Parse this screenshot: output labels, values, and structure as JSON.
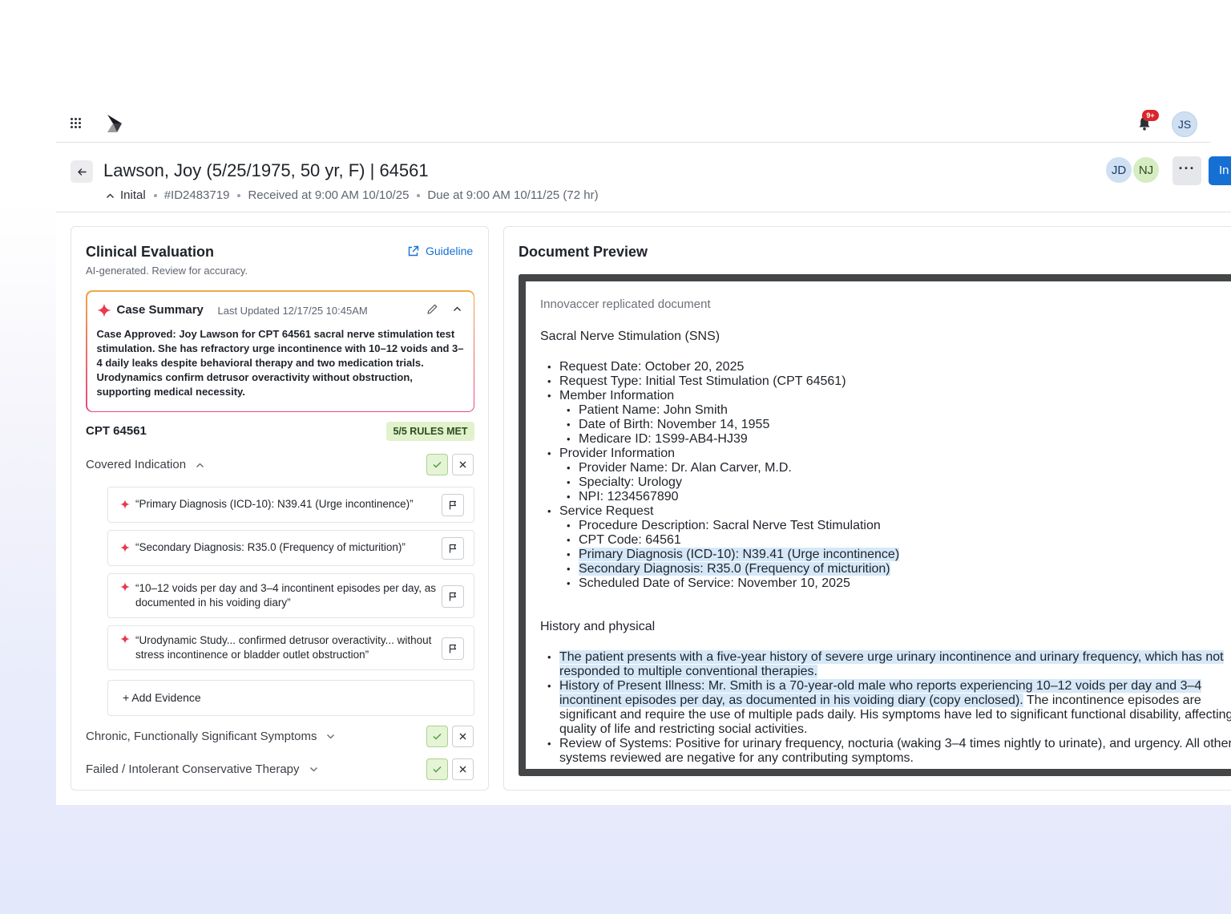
{
  "topbar": {
    "notification_count": "9+",
    "user_initials": "JS"
  },
  "header": {
    "title": "Lawson, Joy (5/25/1975, 50 yr, F) | 64561",
    "stage": "Inital",
    "case_id": "#ID2483719",
    "received": "Received at 9:00 AM 10/10/25",
    "due": "Due at 9:00 AM 10/11/25 (72 hr)",
    "assignees": [
      "JD",
      "NJ"
    ],
    "more_label": "···",
    "primary_button_label": "In"
  },
  "clinical": {
    "title": "Clinical Evaluation",
    "subtitle": "AI-generated. Review for accuracy.",
    "guideline_label": "Guideline",
    "summary": {
      "title": "Case Summary",
      "updated": "Last Updated 12/17/25 10:45AM",
      "body": "Case Approved: Joy Lawson for CPT 64561 sacral nerve stimulation test stimulation. She has refractory urge incontinence with 10–12 voids and 3–4 daily leaks despite behavioral therapy and two medication trials. Urodynamics confirm detrusor overactivity without obstruction, supporting medical necessity."
    },
    "cpt_label": "CPT 64561",
    "rules_badge": "5/5 RULES MET",
    "criteria": [
      {
        "label": "Covered Indication",
        "expanded": true
      },
      {
        "label": "Chronic, Functionally Significant Symptoms",
        "expanded": false
      },
      {
        "label": "Failed / Intolerant Conservative Therapy",
        "expanded": false
      }
    ],
    "evidence": [
      "“Primary Diagnosis (ICD-10): N39.41 (Urge incontinence)”",
      "“Secondary Diagnosis: R35.0 (Frequency of micturition)”",
      "“10–12 voids per day and 3–4 incontinent episodes per day, as documented in his voiding diary”",
      "“Urodynamic Study... confirmed detrusor overactivity... without stress incontinence or bladder outlet obstruction”"
    ],
    "add_evidence_label": "+  Add Evidence"
  },
  "document": {
    "title": "Document Preview",
    "source": "Innovaccer replicated document",
    "heading": "Sacral Nerve Stimulation (SNS)",
    "request_date": "Request Date: October 20, 2025",
    "request_type": "Request Type: Initial Test Stimulation (CPT 64561)",
    "member_info": "Member Information",
    "patient_name": "Patient Name: John Smith",
    "dob": "Date of Birth: November 14, 1955",
    "medicare_id": "Medicare ID: 1S99-AB4-HJ39",
    "provider_info": "Provider Information",
    "provider_name": "Provider Name: Dr. Alan Carver, M.D.",
    "specialty": "Specialty: Urology",
    "npi": "NPI: 1234567890",
    "service_request": "Service Request",
    "procedure": "Procedure Description: Sacral Nerve Test Stimulation",
    "cpt_code": "CPT Code: 64561",
    "primary_dx": "Primary Diagnosis (ICD-10): N39.41 (Urge incontinence)",
    "secondary_dx": "Secondary Diagnosis: R35.0 (Frequency of micturition)",
    "scheduled": "Scheduled Date of Service: November 10, 2025",
    "history_heading": "History and physical",
    "hp1": "The patient presents with a five-year history of severe urge urinary incontinence and urinary frequency, which has not responded to multiple conventional therapies.",
    "hp2_highlight": "History of Present Illness: Mr. Smith is a 70-year-old male who reports experiencing 10–12 voids per day and 3–4 incontinent episodes per day, as documented in his voiding diary (copy enclosed).",
    "hp2_rest": " The incontinence episodes are significant and require the use of multiple pads daily. His symptoms have led to significant functional disability, affecting his quality of life and restricting social activities.",
    "hp3": "Review of Systems: Positive for urinary frequency, nocturia (waking 3–4 times nightly to urinate), and urgency. All other systems reviewed are negative for any contributing symptoms."
  }
}
